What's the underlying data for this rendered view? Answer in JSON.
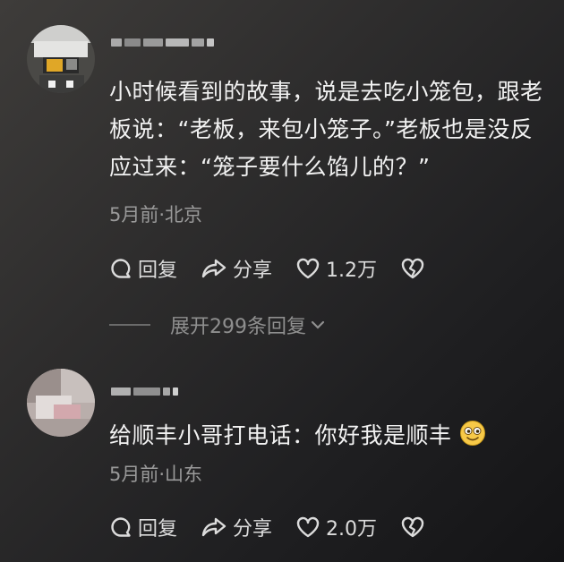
{
  "comments": [
    {
      "text": "小时候看到的故事，说是去吃小笼包，跟老板说：“老板，来包小笼子。”老板也是没反应过来：“笼子要什么馅儿的？”",
      "meta": "5月前·北京",
      "reply_label": "回复",
      "share_label": "分享",
      "like_count": "1.2万"
    },
    {
      "text": "给顺丰小哥打电话：你好我是顺丰",
      "meta": "5月前·山东",
      "reply_label": "回复",
      "share_label": "分享",
      "like_count": "2.0万"
    }
  ],
  "expand_replies_label": "展开299条回复",
  "icons": {
    "reply": "reply-bubble-icon",
    "share": "share-arrow-icon",
    "like": "heart-icon",
    "dislike": "broken-heart-icon",
    "emoji": "smiling-face-emoji"
  }
}
